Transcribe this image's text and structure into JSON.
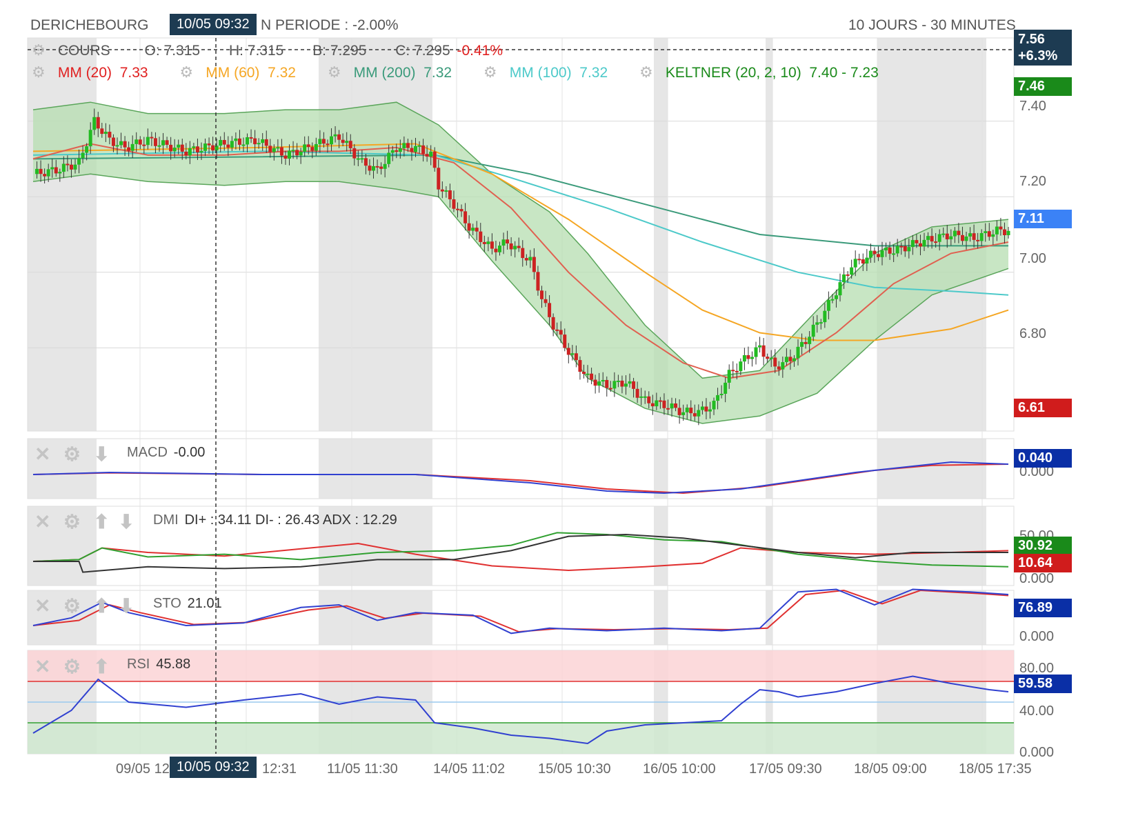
{
  "header": {
    "ticker": "DERICHEBOURG",
    "cursor_time": "10/05 09:32",
    "period_change": "N PERIODE : -2.00%",
    "timeframe": "10 JOURS - 30 MINUTES"
  },
  "cours": {
    "label": "COURS",
    "open": "O: 7.315",
    "high": "H: 7.315",
    "low": "B: 7.295",
    "close": "C: 7.295",
    "change": "-0.41%"
  },
  "overlays": [
    {
      "label": "MM (20)",
      "value": "7.33",
      "color": "#e02020"
    },
    {
      "label": "MM (60)",
      "value": "7.32",
      "color": "#f5a623"
    },
    {
      "label": "MM (200)",
      "value": "7.32",
      "color": "#3a9a7a"
    },
    {
      "label": "MM (100)",
      "value": "7.32",
      "color": "#4cc9c9"
    },
    {
      "label": "KELTNER (20, 2, 10)",
      "value": "7.40 - 7.23",
      "color": "#1a8a1a"
    }
  ],
  "badges": {
    "top_price": "7.56",
    "top_pct": "+6.3%",
    "high": "7.46",
    "last": "7.11",
    "low": "6.61",
    "macd": "0.040",
    "dmi_plus": "30.92",
    "dmi_minus": "10.64",
    "sto": "76.89",
    "rsi": "59.58"
  },
  "colors": {
    "badge_dark": "#1d3b52",
    "badge_green": "#1a8a1a",
    "badge_red": "#d01c1c",
    "badge_blue_bright": "#3b82f6",
    "badge_blue_dark": "#0a2fa6",
    "up": "#22bb22",
    "down": "#cc2222",
    "band_fill": "#b6ddb0",
    "band_line": "#5aa55a",
    "weekend_shade": "#e6e6e6"
  },
  "price_axis": [
    "7.40",
    "7.20",
    "7.00",
    "6.80"
  ],
  "macd_axis": [
    "0.000"
  ],
  "dmi_axis": [
    "50.00",
    "0.000"
  ],
  "sto_axis": [
    "0.000"
  ],
  "rsi_axis": [
    "80.00",
    "40.00",
    "0.000"
  ],
  "indicators": {
    "macd": {
      "label": "MACD",
      "value": "-0.00"
    },
    "dmi": {
      "label": "DMI",
      "value": "DI+ : 34.11 DI- : 26.43 ADX : 12.29"
    },
    "sto": {
      "label": "STO",
      "value": "21.01"
    },
    "rsi": {
      "label": "RSI",
      "value": "45.88"
    }
  },
  "x_axis": [
    "09/05 12",
    "12:31",
    "11/05 11:30",
    "14/05 11:02",
    "15/05 10:30",
    "16/05 10:00",
    "17/05 09:30",
    "18/05 09:00",
    "18/05 17:35"
  ],
  "chart_data": {
    "type": "line",
    "title": "DERICHEBOURG",
    "xlabel": "",
    "ylabel": "",
    "ylim": [
      6.6,
      7.58
    ],
    "price_path": [
      [
        0,
        7.26
      ],
      [
        6,
        7.27
      ],
      [
        12,
        7.29
      ],
      [
        16,
        7.4
      ],
      [
        20,
        7.35
      ],
      [
        24,
        7.33
      ],
      [
        30,
        7.35
      ],
      [
        40,
        7.32
      ],
      [
        50,
        7.34
      ],
      [
        58,
        7.35
      ],
      [
        66,
        7.31
      ],
      [
        72,
        7.33
      ],
      [
        80,
        7.36
      ],
      [
        86,
        7.29
      ],
      [
        90,
        7.27
      ],
      [
        95,
        7.33
      ],
      [
        100,
        7.33
      ],
      [
        104,
        7.31
      ],
      [
        106,
        7.23
      ],
      [
        110,
        7.18
      ],
      [
        114,
        7.12
      ],
      [
        120,
        7.06
      ],
      [
        124,
        7.08
      ],
      [
        130,
        7.03
      ],
      [
        133,
        6.93
      ],
      [
        136,
        6.86
      ],
      [
        140,
        6.79
      ],
      [
        145,
        6.72
      ],
      [
        150,
        6.7
      ],
      [
        155,
        6.71
      ],
      [
        160,
        6.66
      ],
      [
        165,
        6.65
      ],
      [
        170,
        6.63
      ],
      [
        174,
        6.63
      ],
      [
        178,
        6.65
      ],
      [
        182,
        6.73
      ],
      [
        186,
        6.77
      ],
      [
        190,
        6.8
      ],
      [
        194,
        6.75
      ],
      [
        198,
        6.77
      ],
      [
        202,
        6.82
      ],
      [
        206,
        6.88
      ],
      [
        210,
        6.95
      ],
      [
        214,
        7.02
      ],
      [
        220,
        7.05
      ],
      [
        226,
        7.06
      ],
      [
        232,
        7.08
      ],
      [
        240,
        7.1
      ],
      [
        246,
        7.09
      ],
      [
        252,
        7.11
      ],
      [
        255,
        7.11
      ]
    ],
    "keltner_upper": [
      [
        0,
        7.43
      ],
      [
        15,
        7.45
      ],
      [
        30,
        7.42
      ],
      [
        50,
        7.42
      ],
      [
        66,
        7.43
      ],
      [
        80,
        7.43
      ],
      [
        95,
        7.45
      ],
      [
        106,
        7.39
      ],
      [
        120,
        7.26
      ],
      [
        135,
        7.16
      ],
      [
        145,
        7.05
      ],
      [
        160,
        6.86
      ],
      [
        175,
        6.72
      ],
      [
        190,
        6.74
      ],
      [
        205,
        6.9
      ],
      [
        220,
        7.05
      ],
      [
        235,
        7.12
      ],
      [
        255,
        7.14
      ]
    ],
    "keltner_lower": [
      [
        0,
        7.24
      ],
      [
        15,
        7.26
      ],
      [
        30,
        7.24
      ],
      [
        50,
        7.23
      ],
      [
        66,
        7.24
      ],
      [
        80,
        7.24
      ],
      [
        95,
        7.22
      ],
      [
        106,
        7.2
      ],
      [
        120,
        7.03
      ],
      [
        135,
        6.86
      ],
      [
        145,
        6.72
      ],
      [
        160,
        6.64
      ],
      [
        175,
        6.6
      ],
      [
        190,
        6.62
      ],
      [
        205,
        6.68
      ],
      [
        220,
        6.82
      ],
      [
        235,
        6.94
      ],
      [
        255,
        7.01
      ]
    ],
    "mm20": [
      [
        0,
        7.3
      ],
      [
        15,
        7.34
      ],
      [
        30,
        7.31
      ],
      [
        50,
        7.31
      ],
      [
        66,
        7.32
      ],
      [
        80,
        7.32
      ],
      [
        95,
        7.33
      ],
      [
        110,
        7.29
      ],
      [
        125,
        7.17
      ],
      [
        140,
        7.0
      ],
      [
        155,
        6.86
      ],
      [
        170,
        6.76
      ],
      [
        182,
        6.72
      ],
      [
        195,
        6.74
      ],
      [
        210,
        6.84
      ],
      [
        225,
        6.97
      ],
      [
        240,
        7.05
      ],
      [
        255,
        7.08
      ]
    ],
    "mm60": [
      [
        0,
        7.32
      ],
      [
        60,
        7.33
      ],
      [
        100,
        7.34
      ],
      [
        120,
        7.26
      ],
      [
        140,
        7.14
      ],
      [
        160,
        7.0
      ],
      [
        175,
        6.9
      ],
      [
        190,
        6.84
      ],
      [
        205,
        6.82
      ],
      [
        220,
        6.82
      ],
      [
        240,
        6.85
      ],
      [
        255,
        6.9
      ]
    ],
    "mm100": [
      [
        0,
        7.31
      ],
      [
        60,
        7.32
      ],
      [
        105,
        7.31
      ],
      [
        125,
        7.25
      ],
      [
        150,
        7.17
      ],
      [
        175,
        7.08
      ],
      [
        200,
        7.0
      ],
      [
        220,
        6.96
      ],
      [
        240,
        6.95
      ],
      [
        255,
        6.94
      ]
    ],
    "mm200": [
      [
        0,
        7.3
      ],
      [
        105,
        7.31
      ],
      [
        130,
        7.26
      ],
      [
        160,
        7.18
      ],
      [
        190,
        7.1
      ],
      [
        220,
        7.07
      ],
      [
        255,
        7.07
      ]
    ],
    "macd": {
      "macd_line": [
        [
          0,
          0.0
        ],
        [
          20,
          0.005
        ],
        [
          60,
          0.0
        ],
        [
          100,
          0.0
        ],
        [
          130,
          -0.02
        ],
        [
          150,
          -0.04
        ],
        [
          165,
          -0.045
        ],
        [
          185,
          -0.035
        ],
        [
          200,
          -0.015
        ],
        [
          215,
          0.005
        ],
        [
          230,
          0.02
        ],
        [
          240,
          0.03
        ],
        [
          255,
          0.025
        ]
      ],
      "signal_line": [
        [
          0,
          0.0
        ],
        [
          20,
          0.004
        ],
        [
          60,
          0.0
        ],
        [
          100,
          0.0
        ],
        [
          130,
          -0.015
        ],
        [
          150,
          -0.035
        ],
        [
          170,
          -0.045
        ],
        [
          190,
          -0.03
        ],
        [
          205,
          -0.01
        ],
        [
          220,
          0.01
        ],
        [
          235,
          0.022
        ],
        [
          255,
          0.025
        ]
      ]
    },
    "dmi": {
      "di_plus": [
        [
          0,
          20
        ],
        [
          12,
          22
        ],
        [
          18,
          35
        ],
        [
          30,
          25
        ],
        [
          50,
          28
        ],
        [
          70,
          22
        ],
        [
          90,
          30
        ],
        [
          110,
          32
        ],
        [
          125,
          38
        ],
        [
          137,
          52
        ],
        [
          150,
          50
        ],
        [
          165,
          44
        ],
        [
          180,
          42
        ],
        [
          200,
          28
        ],
        [
          220,
          20
        ],
        [
          235,
          16
        ],
        [
          255,
          14
        ]
      ],
      "di_minus": [
        [
          0,
          20
        ],
        [
          12,
          22
        ],
        [
          18,
          35
        ],
        [
          30,
          30
        ],
        [
          50,
          26
        ],
        [
          70,
          34
        ],
        [
          85,
          40
        ],
        [
          100,
          28
        ],
        [
          120,
          15
        ],
        [
          140,
          10
        ],
        [
          160,
          14
        ],
        [
          175,
          18
        ],
        [
          185,
          35
        ],
        [
          200,
          30
        ],
        [
          220,
          28
        ],
        [
          240,
          30
        ],
        [
          255,
          32
        ]
      ],
      "adx": [
        [
          0,
          20
        ],
        [
          12,
          20
        ],
        [
          13,
          8
        ],
        [
          30,
          14
        ],
        [
          50,
          12
        ],
        [
          70,
          14
        ],
        [
          90,
          22
        ],
        [
          110,
          22
        ],
        [
          125,
          32
        ],
        [
          140,
          48
        ],
        [
          155,
          50
        ],
        [
          170,
          46
        ],
        [
          185,
          38
        ],
        [
          200,
          30
        ],
        [
          215,
          24
        ],
        [
          230,
          30
        ],
        [
          255,
          30
        ]
      ]
    },
    "sto": {
      "k_line": [
        [
          0,
          20
        ],
        [
          10,
          35
        ],
        [
          18,
          65
        ],
        [
          25,
          45
        ],
        [
          40,
          20
        ],
        [
          55,
          25
        ],
        [
          70,
          55
        ],
        [
          80,
          60
        ],
        [
          90,
          30
        ],
        [
          100,
          45
        ],
        [
          115,
          40
        ],
        [
          125,
          5
        ],
        [
          135,
          15
        ],
        [
          150,
          10
        ],
        [
          165,
          15
        ],
        [
          180,
          10
        ],
        [
          190,
          15
        ],
        [
          200,
          85
        ],
        [
          210,
          90
        ],
        [
          220,
          60
        ],
        [
          230,
          90
        ],
        [
          245,
          85
        ],
        [
          255,
          80
        ]
      ],
      "d_line": [
        [
          0,
          20
        ],
        [
          12,
          30
        ],
        [
          20,
          60
        ],
        [
          28,
          45
        ],
        [
          42,
          22
        ],
        [
          56,
          26
        ],
        [
          72,
          50
        ],
        [
          82,
          58
        ],
        [
          92,
          34
        ],
        [
          102,
          44
        ],
        [
          117,
          38
        ],
        [
          127,
          8
        ],
        [
          137,
          14
        ],
        [
          152,
          12
        ],
        [
          167,
          14
        ],
        [
          182,
          12
        ],
        [
          192,
          15
        ],
        [
          202,
          80
        ],
        [
          212,
          88
        ],
        [
          222,
          62
        ],
        [
          232,
          88
        ],
        [
          247,
          82
        ],
        [
          255,
          78
        ]
      ]
    },
    "rsi": {
      "rsi_line": [
        [
          0,
          20
        ],
        [
          10,
          42
        ],
        [
          17,
          72
        ],
        [
          25,
          50
        ],
        [
          40,
          45
        ],
        [
          55,
          52
        ],
        [
          70,
          58
        ],
        [
          80,
          48
        ],
        [
          90,
          55
        ],
        [
          100,
          52
        ],
        [
          105,
          30
        ],
        [
          115,
          25
        ],
        [
          125,
          18
        ],
        [
          135,
          15
        ],
        [
          145,
          10
        ],
        [
          150,
          22
        ],
        [
          160,
          28
        ],
        [
          170,
          30
        ],
        [
          180,
          32
        ],
        [
          185,
          48
        ],
        [
          190,
          62
        ],
        [
          195,
          60
        ],
        [
          200,
          55
        ],
        [
          210,
          60
        ],
        [
          220,
          68
        ],
        [
          230,
          75
        ],
        [
          240,
          68
        ],
        [
          250,
          62
        ],
        [
          255,
          60
        ]
      ],
      "overbought": 70,
      "oversold": 30,
      "mid": 50
    }
  }
}
